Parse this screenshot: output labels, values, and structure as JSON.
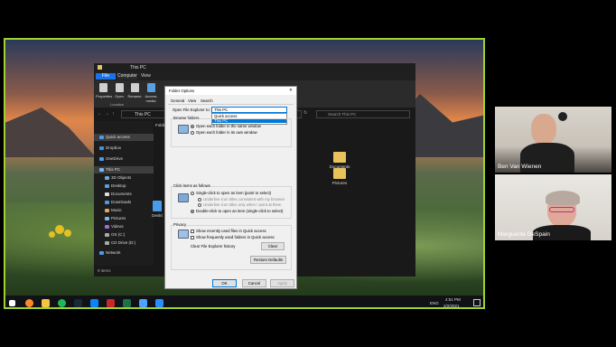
{
  "explorer": {
    "title": "This PC",
    "tabs": [
      "File",
      "Computer",
      "View"
    ],
    "ribbon": [
      "Properties",
      "Open",
      "Rename",
      "Access media",
      "Map"
    ],
    "ribbon_group": "Location",
    "address": "This PC",
    "search_placeholder": "Search This PC",
    "nav": [
      "Quick access",
      "Dropbox",
      "OneDrive",
      "This PC",
      "3D Objects",
      "Desktop",
      "Documents",
      "Downloads",
      "Music",
      "Pictures",
      "Videos",
      "OS (C:)",
      "CD Drive (D:)",
      "Network"
    ],
    "folders_header": "Folders",
    "folders": [
      "Documents",
      "Pictures",
      "Deskt"
    ],
    "status": "9 items"
  },
  "dialog": {
    "title": "Folder Options",
    "tabs": [
      "General",
      "View",
      "Search"
    ],
    "open_label": "Open File Explorer to:",
    "open_value": "This PC",
    "dropdown_options": [
      "Quick access",
      "This PC"
    ],
    "browse_label": "Browse folders",
    "browse_options": [
      "Open each folder in the same window",
      "Open each folder in its own window"
    ],
    "click_label": "Click items as follows",
    "click_options": [
      "Single-click to open an item (point to select)",
      "Underline icon titles consistent with my browser",
      "Underline icon titles only when I point at them",
      "Double-click to open an item (single-click to select)"
    ],
    "privacy_label": "Privacy",
    "privacy_options": [
      "Show recently used files in Quick access",
      "Show frequently used folders in Quick access"
    ],
    "clear_label": "Clear File Explorer history",
    "clear_btn": "Clear",
    "restore_btn": "Restore Defaults",
    "ok": "OK",
    "cancel": "Cancel",
    "apply": "Apply"
  },
  "taskbar": {
    "lang": "ENG",
    "time": "4:51 PM",
    "date": "2/2/2021"
  },
  "participants": [
    "Ben Van Wienen",
    "Marguerite DeSpain"
  ],
  "colors": {
    "speaker_border": "#9fd133",
    "selection": "#0078d7"
  }
}
